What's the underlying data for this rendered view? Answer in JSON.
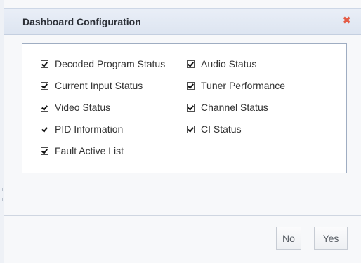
{
  "dialog": {
    "title": "Dashboard Configuration",
    "close_glyph": "✖",
    "close_icon": "close-icon",
    "close_color": "#e45b45"
  },
  "options": [
    {
      "label": "Decoded Program Status",
      "checked": true
    },
    {
      "label": "Current Input Status",
      "checked": true
    },
    {
      "label": "Video Status",
      "checked": true
    },
    {
      "label": "PID Information",
      "checked": true
    },
    {
      "label": "Fault Active List",
      "checked": true
    },
    {
      "label": "Audio Status",
      "checked": true
    },
    {
      "label": "Tuner Performance",
      "checked": true
    },
    {
      "label": "Channel Status",
      "checked": true
    },
    {
      "label": "CI Status",
      "checked": true
    }
  ],
  "footer": {
    "no_label": "No",
    "yes_label": "Yes"
  }
}
